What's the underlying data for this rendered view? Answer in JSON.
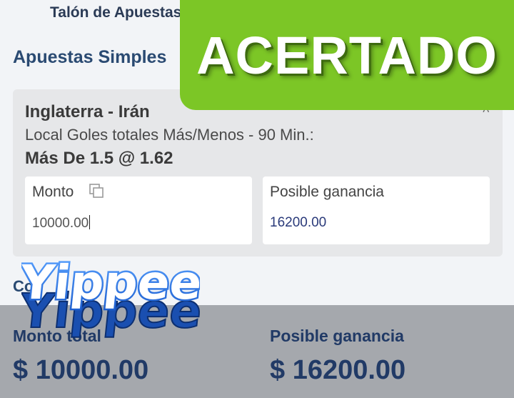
{
  "header": {
    "title": "Talón de Apuestas"
  },
  "section": {
    "title": "Apuestas Simples"
  },
  "bet": {
    "match": "Inglaterra - Irán",
    "market": "Local Goles totales Más/Menos - 90 Min.:",
    "selection": "Más De 1.5 @ 1.62",
    "stake_label": "Monto",
    "stake_value": "10000.00",
    "payout_label": "Posible ganancia",
    "payout_value": "16200.00"
  },
  "combo": {
    "label": "Co"
  },
  "footer": {
    "total_stake_label": "Monto total",
    "total_stake_value": "$ 10000.00",
    "total_payout_label": "Posible ganancia",
    "total_payout_value": "$ 16200.00"
  },
  "overlays": {
    "acertado_text": "ACERTADO",
    "acertado_color": "#7cc626",
    "yippee_text": "Yippee!",
    "yippee_color": "#2f7ee8"
  },
  "icons": {
    "copy": "copy-icon",
    "collapse": "chevron-up-icon"
  }
}
